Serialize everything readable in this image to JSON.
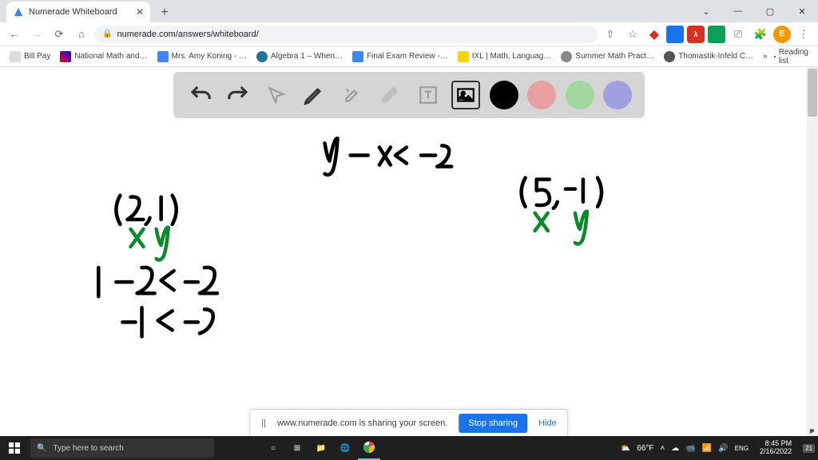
{
  "browser": {
    "tab_title": "Numerade Whiteboard",
    "url": "numerade.com/answers/whiteboard/",
    "new_tab": "+",
    "win_min": "—",
    "win_max": "▢",
    "win_close": "✕",
    "chevron": "⌄"
  },
  "nav": {
    "back": "←",
    "forward": "→",
    "reload": "⟳",
    "home": "⌂",
    "lock": "🔒",
    "share": "⇧",
    "star": "☆",
    "cast": "⎚",
    "puzzle": "🧩",
    "menu": "⋮",
    "more": "»",
    "profile": "E"
  },
  "bookmarks": {
    "b1": "Bill Pay",
    "b2": "National Math and…",
    "b3": "Mrs. Amy Koning - …",
    "b4": "Algebra 1 – When…",
    "b5": "Final Exam Review -…",
    "b6": "IXL | Math, Languag…",
    "b7": "Summer Math Pract…",
    "b8": "Thomastik-Infeld C…",
    "readlist": "Reading list"
  },
  "whiteboard": {
    "tools": {
      "undo": "undo",
      "redo": "redo",
      "pointer": "pointer",
      "pen": "pen",
      "tools": "tools",
      "eraser": "eraser",
      "text": "text",
      "image": "image"
    },
    "colors": {
      "black": "#000000",
      "red": "#e8a0a0",
      "green": "#a0d8a0",
      "purple": "#a0a0e0"
    },
    "handwriting": {
      "line1": "y − x < -2",
      "point1": "(2, 1)",
      "xy1": "x  y",
      "point2": "(5, -1)",
      "xy2": "x   y",
      "calc1": "1 − 2 < -2",
      "calc2": "-1 < -2"
    }
  },
  "sharebar": {
    "msg": "www.numerade.com is sharing your screen.",
    "stop": "Stop sharing",
    "hide": "Hide",
    "pause": "||"
  },
  "taskbar": {
    "search_placeholder": "Type here to search",
    "weather_temp": "66°F",
    "time": "8:45 PM",
    "date": "2/16/2022",
    "notif": "21"
  }
}
